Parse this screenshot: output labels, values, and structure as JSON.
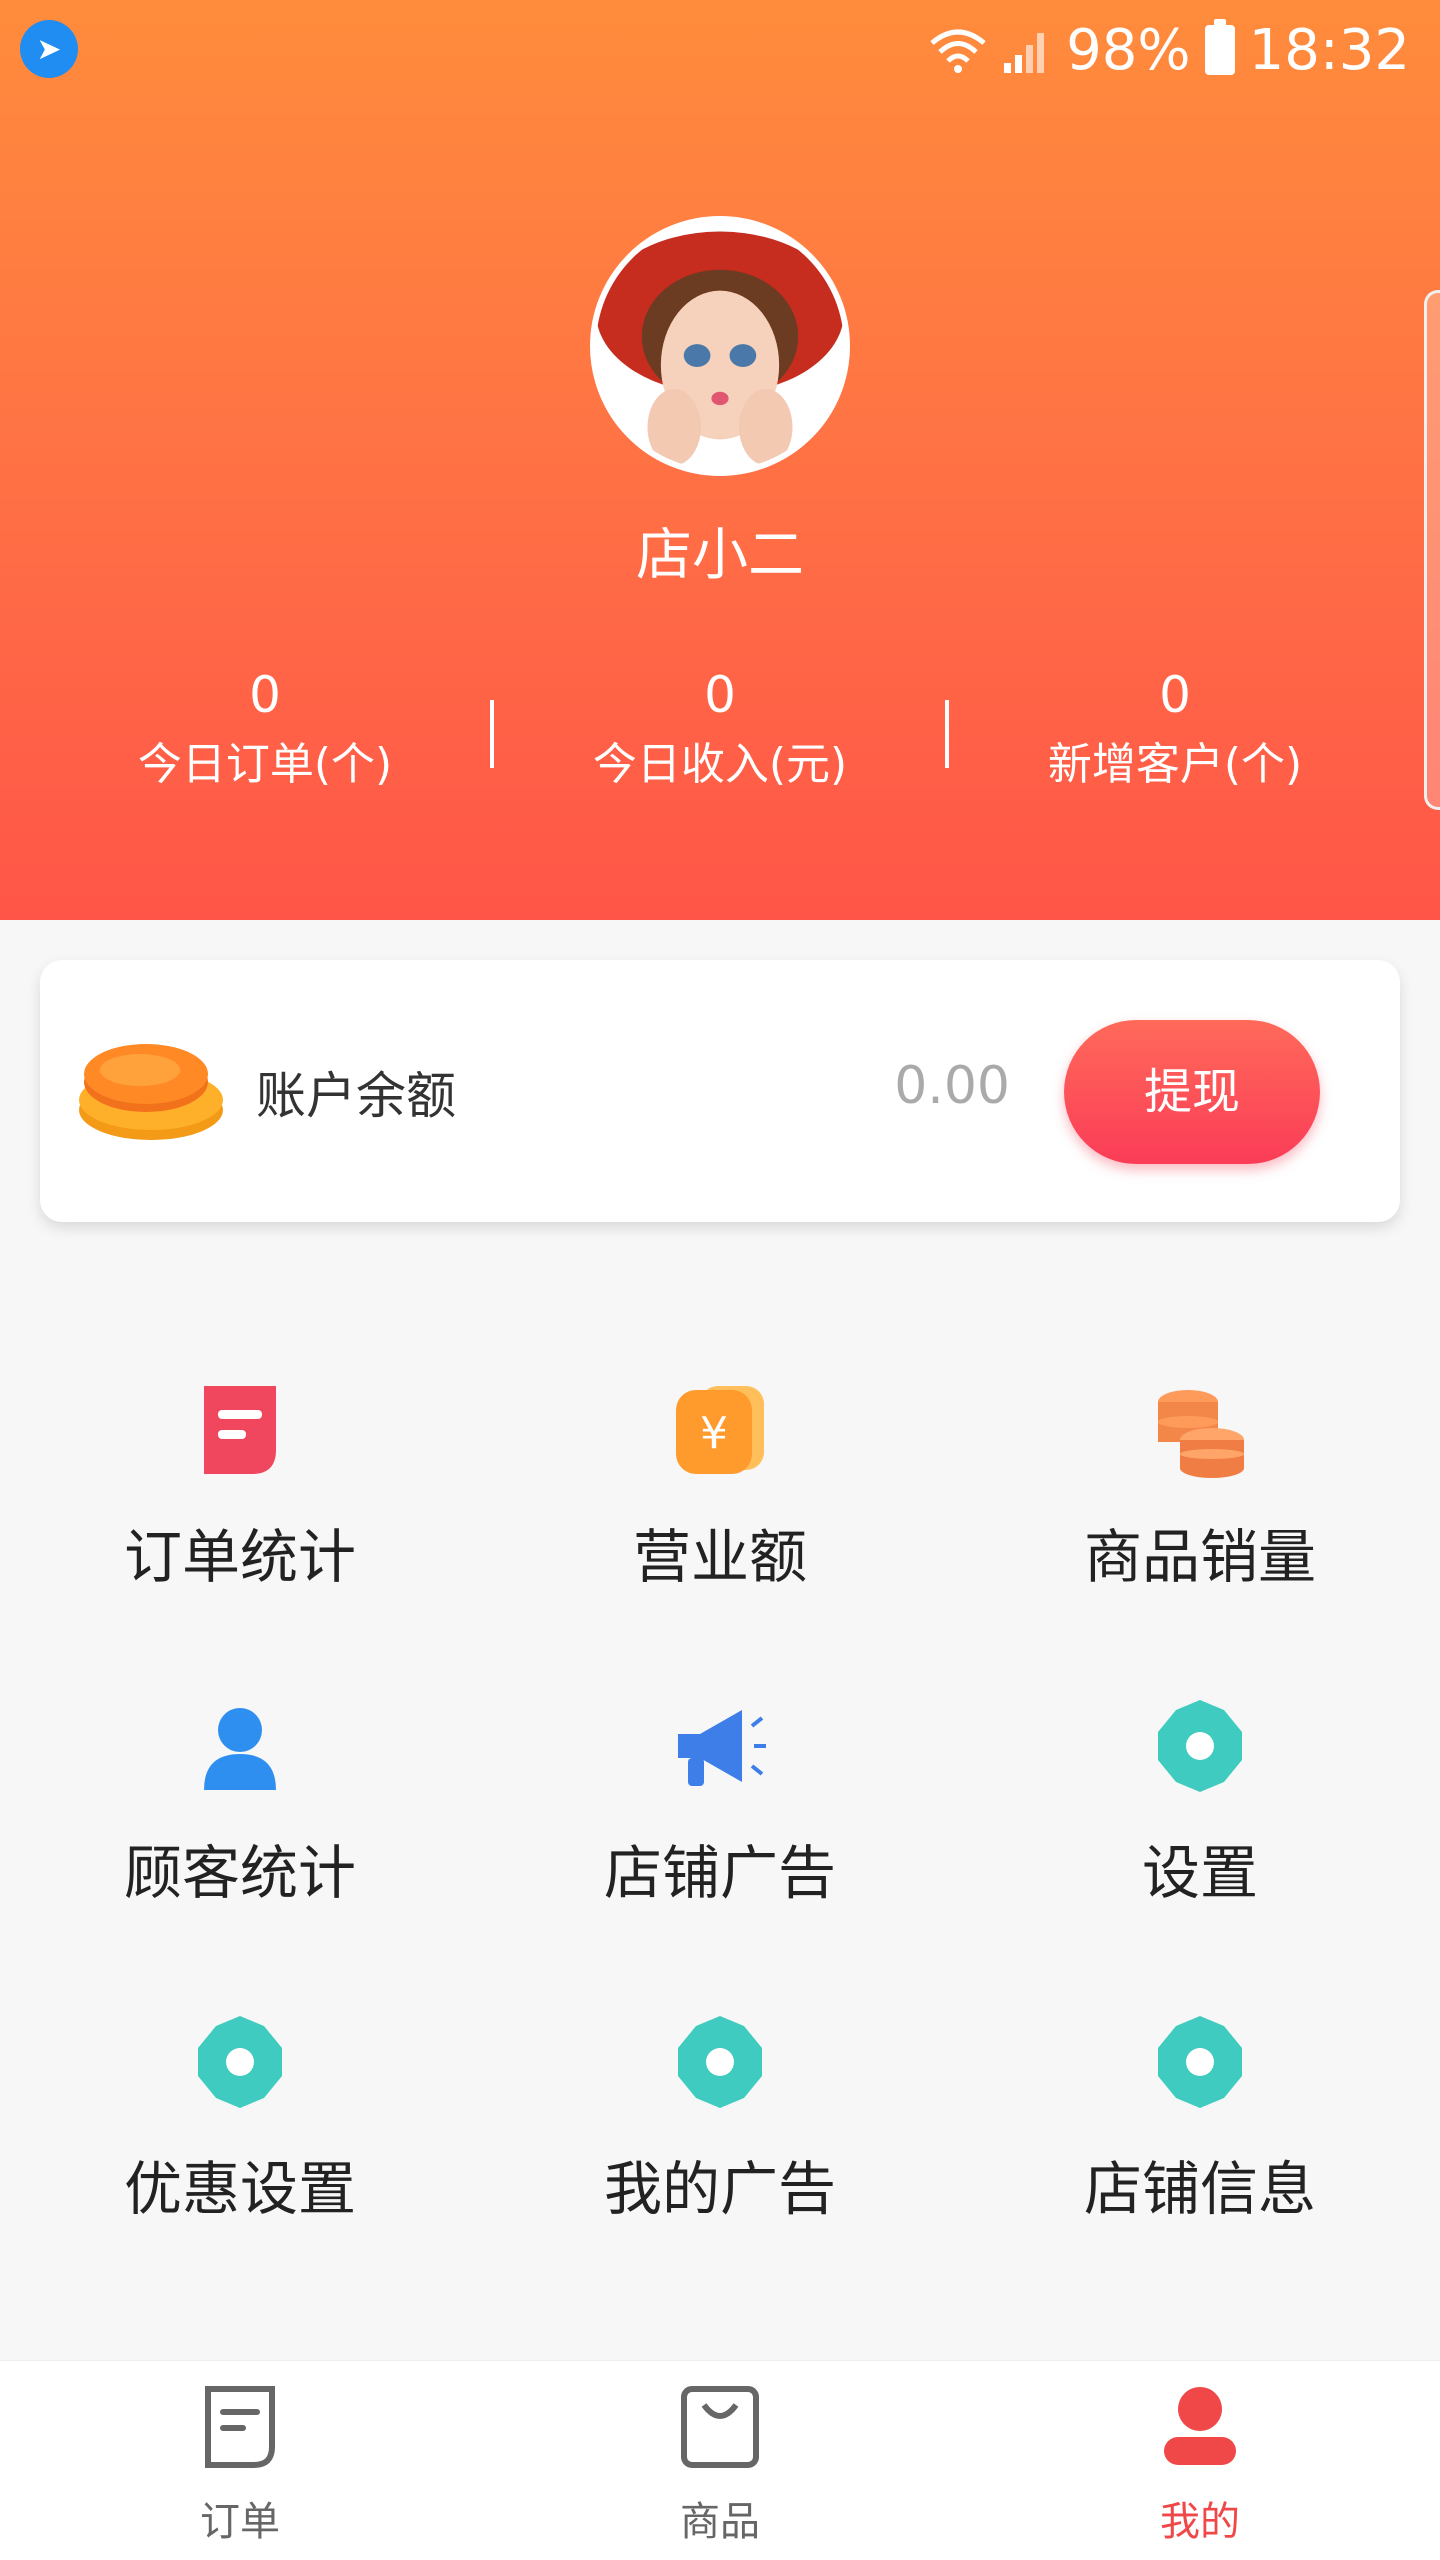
{
  "status_bar": {
    "battery": "98%",
    "time": "18:32",
    "app_icon": "dingtalk-icon"
  },
  "profile": {
    "shop_name": "店小二"
  },
  "stats": [
    {
      "value": "0",
      "label": "今日订单(个)"
    },
    {
      "value": "0",
      "label": "今日收入(元)"
    },
    {
      "value": "0",
      "label": "新增客户(个)"
    }
  ],
  "balance": {
    "label": "账户余额",
    "value": "0.00",
    "withdraw_label": "提现"
  },
  "menu": [
    {
      "label": "订单统计",
      "icon": "order-doc-icon"
    },
    {
      "label": "营业额",
      "icon": "yuan-cards-icon"
    },
    {
      "label": "商品销量",
      "icon": "coins-stack-icon"
    },
    {
      "label": "顾客统计",
      "icon": "person-icon"
    },
    {
      "label": "店铺广告",
      "icon": "megaphone-icon"
    },
    {
      "label": "设置",
      "icon": "gear-icon"
    },
    {
      "label": "优惠设置",
      "icon": "gear-icon"
    },
    {
      "label": "我的广告",
      "icon": "gear-icon"
    },
    {
      "label": "店铺信息",
      "icon": "gear-icon"
    }
  ],
  "tabbar": [
    {
      "label": "订单",
      "icon": "order-tab-icon",
      "active": false
    },
    {
      "label": "商品",
      "icon": "bag-tab-icon",
      "active": false
    },
    {
      "label": "我的",
      "icon": "profile-tab-icon",
      "active": true
    }
  ],
  "colors": {
    "header_top": "#ff8c3c",
    "header_bottom": "#ff5548",
    "accent": "#f04848",
    "teal": "#3fcbc0"
  }
}
